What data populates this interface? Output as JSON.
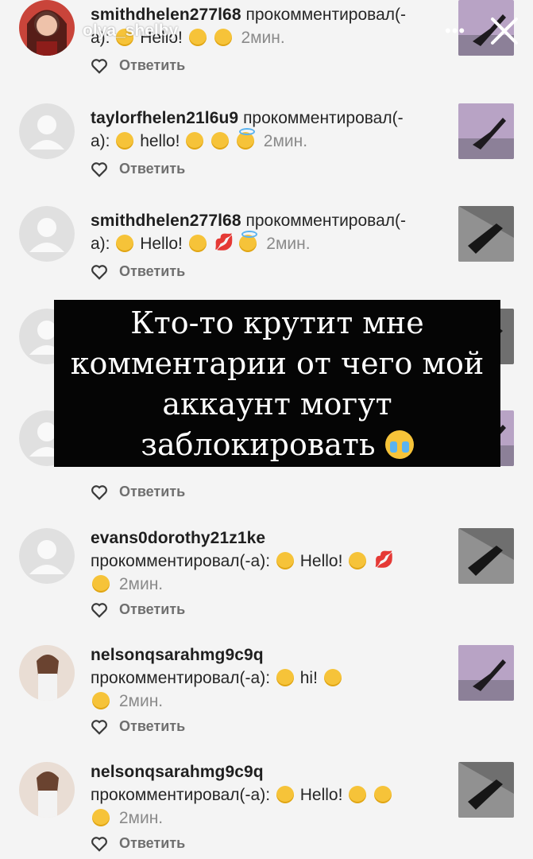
{
  "story": {
    "username_overlay": "olya_shelby",
    "dots": "•••"
  },
  "overlay_text": {
    "line1": "Кто-то крутит мне",
    "line2": "комментарии от чего мой",
    "line3": "аккаунт могут",
    "line4": "заблокировать"
  },
  "verb": "прокомментировал(-",
  "verb_cont": "а):",
  "verb_full": "прокомментировал(-а):",
  "reply_label": "Ответить",
  "time_label": "2мин.",
  "comments": [
    {
      "user": "smithdhelen277l68",
      "text": "Hello!",
      "time": "2мин."
    },
    {
      "user": "taylorfhelen21l6u9",
      "text": "hello!",
      "time": "2мин."
    },
    {
      "user": "smithdhelen277l68",
      "text": "Hello!",
      "time": "2мин."
    },
    {
      "user": "evans0dorothy21z1ke",
      "text": "Hello!",
      "time": "2мин."
    },
    {
      "user": "nelsonqsarahmg9c9q",
      "text": "hi!",
      "time": "2мин."
    },
    {
      "user": "nelsonqsarahmg9c9q",
      "text": "Hello!",
      "time": "2мин."
    }
  ],
  "colors": {
    "background": "#f4f4f4",
    "overlay_bg": "#050505",
    "username": "#1f1f1f",
    "muted": "#8a8a8a"
  },
  "icons": [
    "heart-icon",
    "close-icon",
    "default-avatar-icon"
  ]
}
